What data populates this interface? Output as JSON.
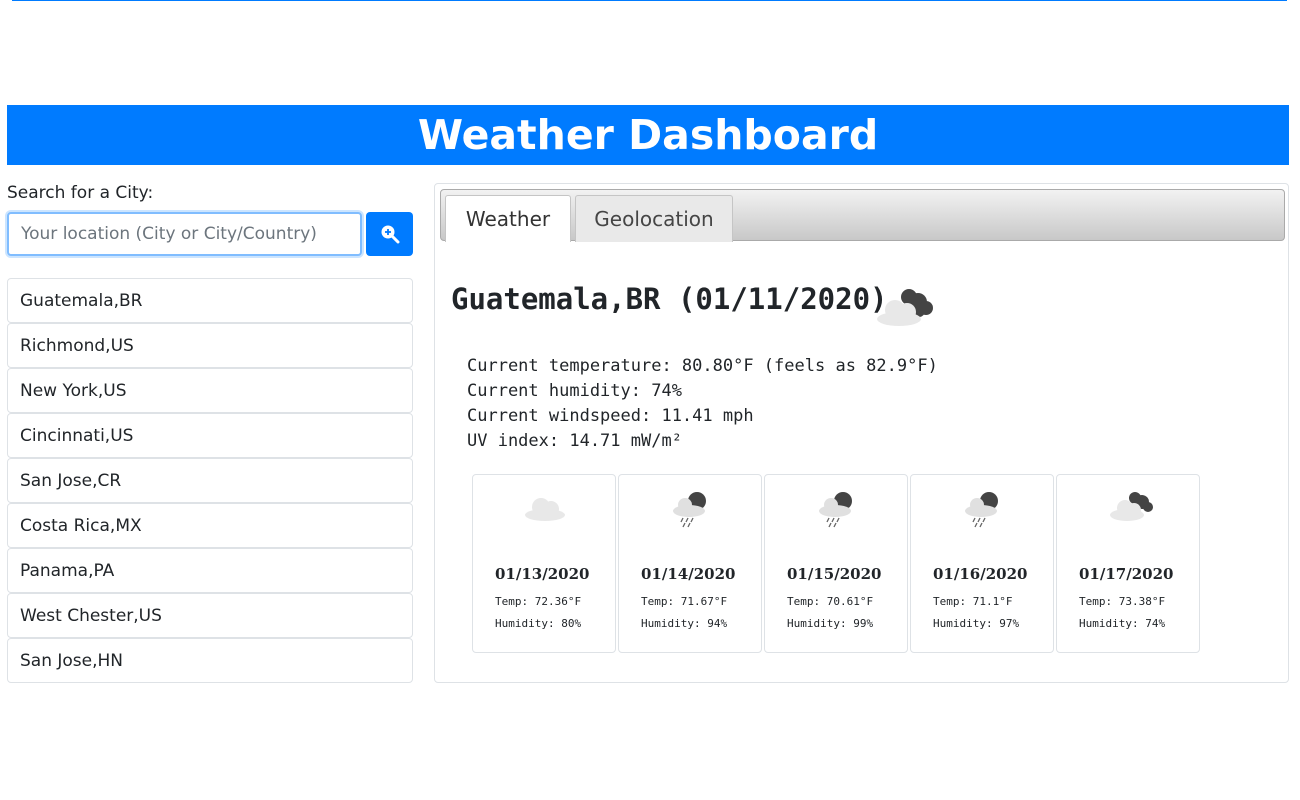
{
  "header": {
    "title": "Weather Dashboard"
  },
  "search": {
    "label": "Search for a City:",
    "placeholder": "Your location (City or City/Country)",
    "button_icon": "search-zoom-icon"
  },
  "cities": [
    "Guatemala,BR",
    "Richmond,US",
    "New York,US",
    "Cincinnati,US",
    "San Jose,CR",
    "Costa Rica,MX",
    "Panama,PA",
    "West Chester,US",
    "San Jose,HN"
  ],
  "tabs": [
    {
      "label": "Weather",
      "active": true
    },
    {
      "label": "Geolocation",
      "active": false
    }
  ],
  "current": {
    "title": "Guatemala,BR (01/11/2020)",
    "icon": "broken-clouds-icon",
    "temperature": "Current temperature: 80.80°F (feels as 82.9°F)",
    "humidity": "Current humidity: 74%",
    "windspeed": "Current windspeed: 11.41 mph",
    "uv": "UV index: 14.71 mW/m²"
  },
  "forecast": [
    {
      "date": "01/13/2020",
      "temp": "Temp: 72.36°F",
      "humidity": "Humidity: 80%",
      "icon": "cloud-icon"
    },
    {
      "date": "01/14/2020",
      "temp": "Temp: 71.67°F",
      "humidity": "Humidity: 94%",
      "icon": "rain-cloud-icon"
    },
    {
      "date": "01/15/2020",
      "temp": "Temp: 70.61°F",
      "humidity": "Humidity: 99%",
      "icon": "rain-cloud-icon"
    },
    {
      "date": "01/16/2020",
      "temp": "Temp: 71.1°F",
      "humidity": "Humidity: 97%",
      "icon": "rain-cloud-icon"
    },
    {
      "date": "01/17/2020",
      "temp": "Temp: 73.38°F",
      "humidity": "Humidity: 74%",
      "icon": "broken-clouds-icon"
    }
  ],
  "colors": {
    "primary": "#007bff",
    "border": "#dee2e6",
    "cloud_light": "#e8e8e8",
    "cloud_dark": "#444444"
  }
}
